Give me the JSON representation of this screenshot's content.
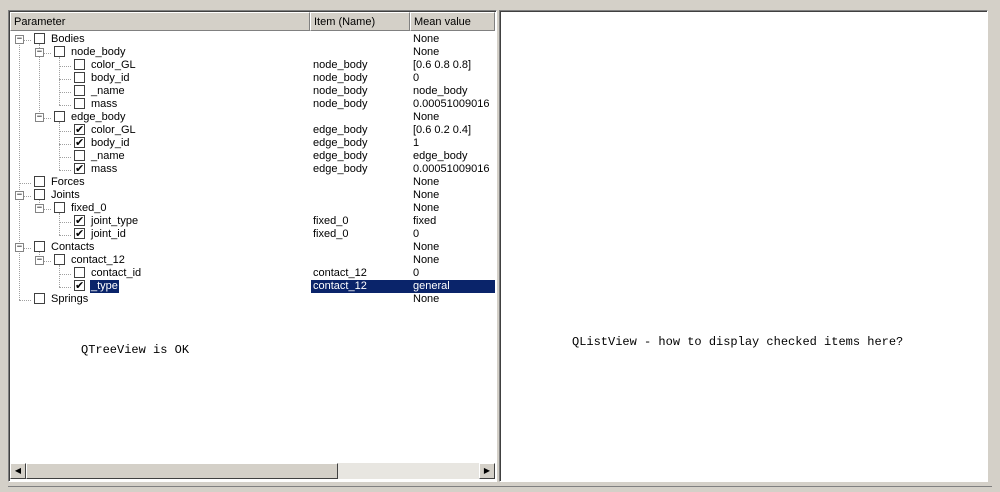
{
  "tree": {
    "columns": [
      "Parameter",
      "Item (Name)",
      "Mean value"
    ],
    "rows": [
      {
        "label": "Bodies",
        "item": "",
        "mean": "None",
        "level": 0,
        "checked": false,
        "expander": "-",
        "selected": false
      },
      {
        "label": "node_body",
        "item": "",
        "mean": "None",
        "level": 1,
        "checked": false,
        "expander": "-",
        "selected": false
      },
      {
        "label": "color_GL",
        "item": "node_body",
        "mean": "[0.6 0.8 0.8]",
        "level": 2,
        "checked": false,
        "expander": "",
        "selected": false
      },
      {
        "label": "body_id",
        "item": "node_body",
        "mean": "0",
        "level": 2,
        "checked": false,
        "expander": "",
        "selected": false
      },
      {
        "label": "_name",
        "item": "node_body",
        "mean": "node_body",
        "level": 2,
        "checked": false,
        "expander": "",
        "selected": false
      },
      {
        "label": "mass",
        "item": "node_body",
        "mean": "0.00051009016",
        "level": 2,
        "checked": false,
        "expander": "",
        "selected": false
      },
      {
        "label": "edge_body",
        "item": "",
        "mean": "None",
        "level": 1,
        "checked": false,
        "expander": "-",
        "selected": false
      },
      {
        "label": "color_GL",
        "item": "edge_body",
        "mean": "[0.6 0.2 0.4]",
        "level": 2,
        "checked": true,
        "expander": "",
        "selected": false
      },
      {
        "label": "body_id",
        "item": "edge_body",
        "mean": "1",
        "level": 2,
        "checked": true,
        "expander": "",
        "selected": false
      },
      {
        "label": "_name",
        "item": "edge_body",
        "mean": "edge_body",
        "level": 2,
        "checked": false,
        "expander": "",
        "selected": false
      },
      {
        "label": "mass",
        "item": "edge_body",
        "mean": "0.00051009016",
        "level": 2,
        "checked": true,
        "expander": "",
        "selected": false
      },
      {
        "label": "Forces",
        "item": "",
        "mean": "None",
        "level": 0,
        "checked": false,
        "expander": "",
        "selected": false
      },
      {
        "label": "Joints",
        "item": "",
        "mean": "None",
        "level": 0,
        "checked": false,
        "expander": "-",
        "selected": false
      },
      {
        "label": "fixed_0",
        "item": "",
        "mean": "None",
        "level": 1,
        "checked": false,
        "expander": "-",
        "selected": false
      },
      {
        "label": "joint_type",
        "item": "fixed_0",
        "mean": "fixed",
        "level": 2,
        "checked": true,
        "expander": "",
        "selected": false
      },
      {
        "label": "joint_id",
        "item": "fixed_0",
        "mean": "0",
        "level": 2,
        "checked": true,
        "expander": "",
        "selected": false
      },
      {
        "label": "Contacts",
        "item": "",
        "mean": "None",
        "level": 0,
        "checked": false,
        "expander": "-",
        "selected": false
      },
      {
        "label": "contact_12",
        "item": "",
        "mean": "None",
        "level": 1,
        "checked": false,
        "expander": "-",
        "selected": false
      },
      {
        "label": "contact_id",
        "item": "contact_12",
        "mean": "0",
        "level": 2,
        "checked": false,
        "expander": "",
        "selected": false
      },
      {
        "label": "_type",
        "item": "contact_12",
        "mean": "general",
        "level": 2,
        "checked": true,
        "expander": "",
        "selected": true
      },
      {
        "label": "Springs",
        "item": "",
        "mean": "None",
        "level": 0,
        "checked": false,
        "expander": "",
        "selected": false
      }
    ]
  },
  "left_note": "QTreeView is OK",
  "right_note": "QListView - how to display checked items here?",
  "glyphs": {
    "check": "✔",
    "minus": "−",
    "arrow_left": "◀",
    "arrow_right": "▶"
  },
  "colors": {
    "selection": "#0a246a",
    "panel": "#d4d0c8"
  }
}
